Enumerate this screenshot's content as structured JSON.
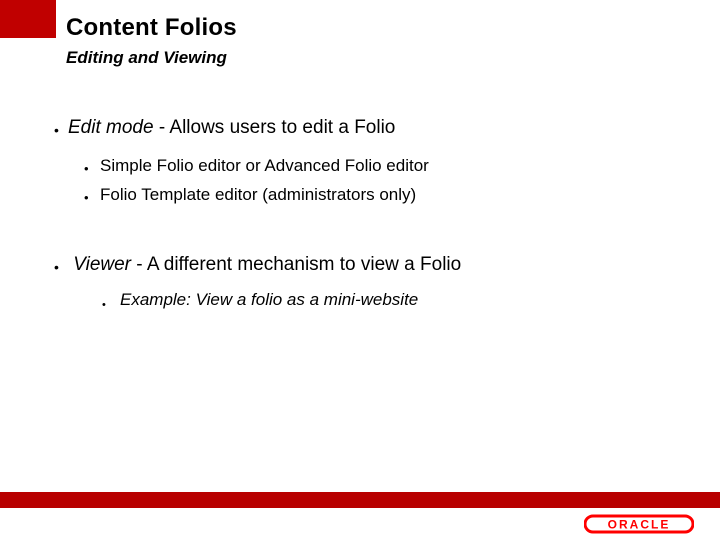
{
  "colors": {
    "accent_red": "#c00000",
    "footer_red": "#b80000",
    "logo_red": "#ff0000"
  },
  "title": "Content Folios",
  "subtitle": "Editing and Viewing",
  "bullets": [
    {
      "lead": "Edit mode",
      "sep": " - ",
      "rest": "Allows users to edit a Folio",
      "sub": [
        "Simple Folio editor or Advanced Folio editor",
        "Folio Template editor (administrators only)"
      ]
    },
    {
      "lead": "Viewer",
      "sep": "  - ",
      "rest": "A different mechanism to view a Folio",
      "sub_italic": [
        "Example: View a folio as a mini-website"
      ]
    }
  ],
  "logo_text": "ORACLE"
}
